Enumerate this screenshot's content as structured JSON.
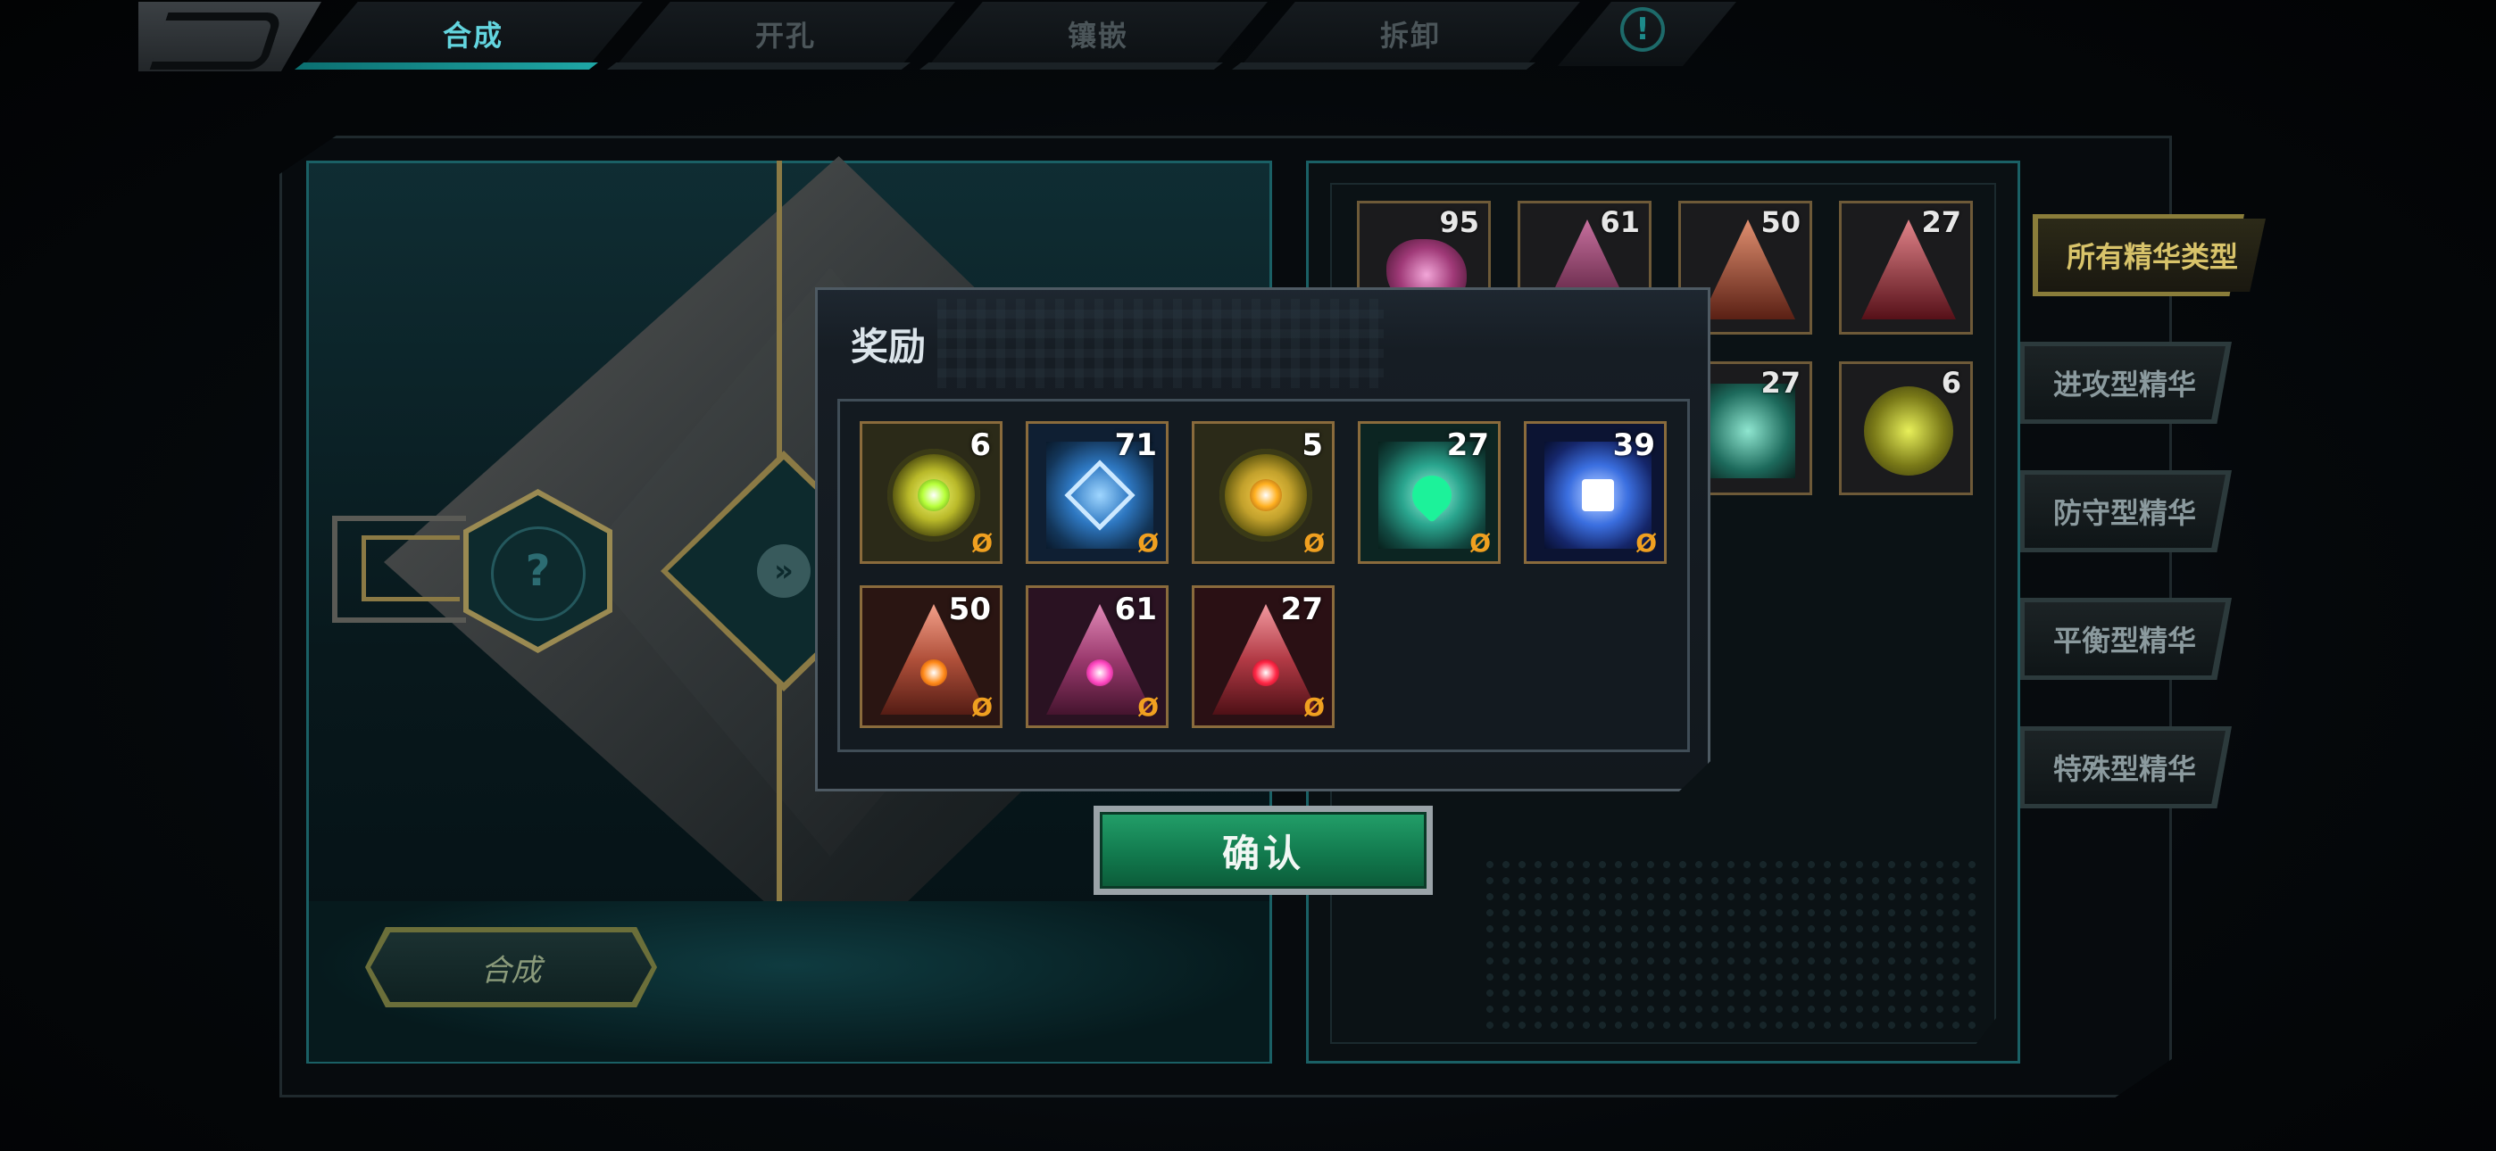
{
  "tabs": [
    {
      "label": "合成",
      "active": true
    },
    {
      "label": "开孔",
      "active": false
    },
    {
      "label": "镶嵌",
      "active": false
    },
    {
      "label": "拆卸",
      "active": false
    }
  ],
  "info_icon": "!",
  "left_panel": {
    "slot_placeholder": "?",
    "compose_button": "合成"
  },
  "inventory": {
    "items": [
      {
        "count": "95",
        "gem": "rose-ore"
      },
      {
        "count": "61",
        "gem": "pink-triangle"
      },
      {
        "count": "50",
        "gem": "orange-triangle"
      },
      {
        "count": "27",
        "gem": "red-triangle"
      },
      {
        "count": "27",
        "gem": "teal-square"
      },
      {
        "count": "6",
        "gem": "gold-orb"
      }
    ]
  },
  "filters": [
    {
      "label": "所有精华类型",
      "selected": true
    },
    {
      "label": "进攻型精华",
      "selected": false
    },
    {
      "label": "防守型精华",
      "selected": false
    },
    {
      "label": "平衡型精华",
      "selected": false
    },
    {
      "label": "特殊型精华",
      "selected": false
    }
  ],
  "dialog": {
    "title": "奖励",
    "lock_symbol": "Ø",
    "rewards": [
      {
        "count": "6",
        "gem": "gold-orb"
      },
      {
        "count": "71",
        "gem": "blue-square"
      },
      {
        "count": "5",
        "gem": "gold-orb-orange"
      },
      {
        "count": "27",
        "gem": "teal-square"
      },
      {
        "count": "39",
        "gem": "navy-square"
      },
      {
        "count": "50",
        "gem": "orange-triangle"
      },
      {
        "count": "61",
        "gem": "pink-triangle"
      },
      {
        "count": "27",
        "gem": "red-triangle"
      }
    ],
    "confirm_button": "确认"
  },
  "colors": {
    "accent_teal": "#63d5df",
    "gold": "#d8c36a",
    "confirm_green": "#127a4e",
    "lock_orange": "#f0a020"
  }
}
